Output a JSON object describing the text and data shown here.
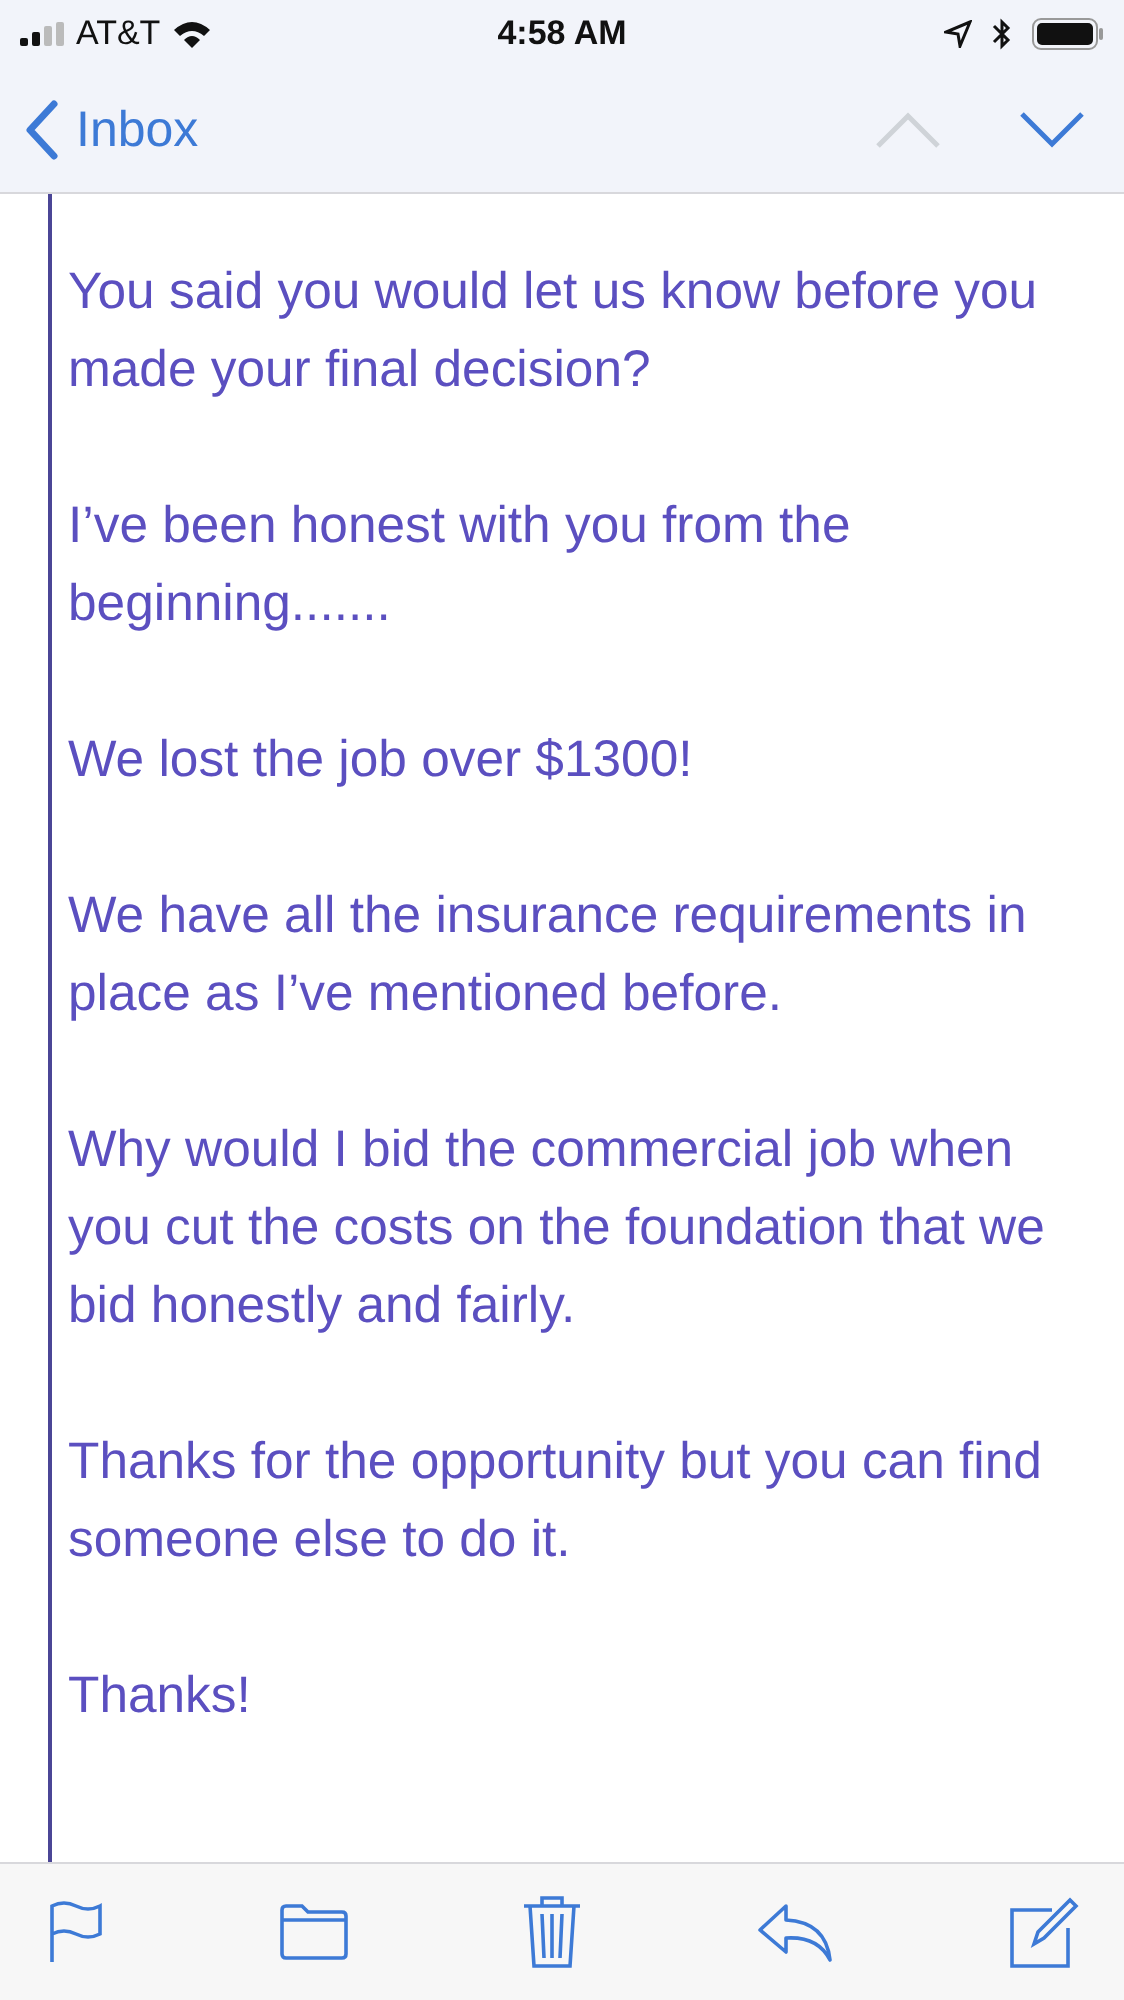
{
  "status_bar": {
    "carrier": "AT&T",
    "time": "4:58 AM"
  },
  "nav_bar": {
    "back_label": "Inbox",
    "previous_disabled": true,
    "next_disabled": false
  },
  "message": {
    "paragraphs": [
      "You said you would let us know before you made your final decision?",
      "I’ve been honest with you from the beginning.......",
      "We lost the job over $1300!",
      "We have all the insurance requirements in place as I’ve mentioned before.",
      "Why would I bid the commercial job when you cut the costs on the foundation that we bid honestly and fairly.",
      "Thanks for the opportunity but you can find someone else to do it.",
      "Thanks!"
    ]
  }
}
